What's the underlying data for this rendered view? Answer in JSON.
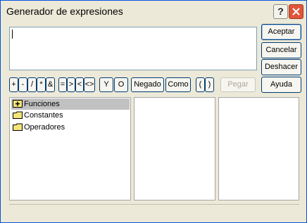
{
  "window": {
    "title": "Generador de expresiones"
  },
  "titlebar": {
    "help_label": "?"
  },
  "expression": {
    "value": ""
  },
  "side_buttons": {
    "accept": "Aceptar",
    "cancel": "Cancelar",
    "undo": "Deshacer",
    "help": "Ayuda"
  },
  "operators": {
    "plus": "+",
    "minus": "-",
    "divide": "/",
    "multiply": "*",
    "concat": "&",
    "equals": "=",
    "greater": ">",
    "less": "<",
    "notequal": "<>",
    "and": "Y",
    "or": "O",
    "not": "Negado",
    "like": "Como",
    "lparen": "(",
    "rparen": ")",
    "paste": "Pegar"
  },
  "tree": {
    "items": [
      {
        "label": "Funciones",
        "icon": "folder-expand-icon",
        "selected": true
      },
      {
        "label": "Constantes",
        "icon": "folder-icon",
        "selected": false
      },
      {
        "label": "Operadores",
        "icon": "folder-icon",
        "selected": false
      }
    ]
  },
  "colors": {
    "title_bg": "#ece9d8",
    "close": "#e0553a",
    "selection": "#c1c1c1",
    "border": "#003c74"
  }
}
